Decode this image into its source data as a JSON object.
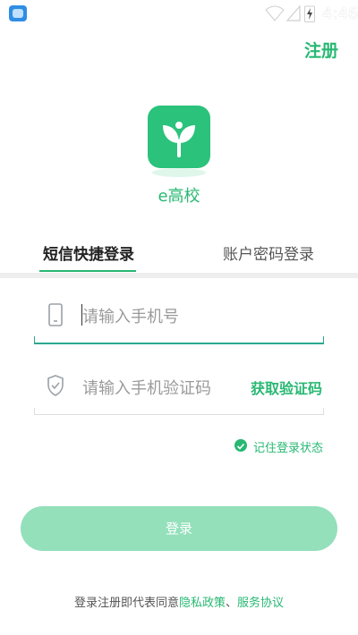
{
  "status_bar": {
    "time": "4:46"
  },
  "header": {
    "register_label": "注册"
  },
  "app": {
    "name": "e高校"
  },
  "tabs": [
    {
      "label": "短信快捷登录",
      "active": true
    },
    {
      "label": "账户密码登录",
      "active": false
    }
  ],
  "form": {
    "phone_placeholder": "请输入手机号",
    "code_placeholder": "请输入手机验证码",
    "get_code_label": "获取验证码",
    "remember_label": "记住登录状态",
    "login_label": "登录"
  },
  "footer": {
    "prefix": "登录注册即代表同意",
    "privacy_label": "隐私政策",
    "separator": "、",
    "service_label": "服务协议"
  },
  "colors": {
    "accent": "#28b873",
    "button_disabled": "#93e0bb",
    "focus_underline": "#2aa88f"
  },
  "icons": [
    "wifi-icon",
    "signal-icon",
    "battery-charging-icon",
    "phone-icon",
    "shield-icon",
    "check-circle-icon",
    "leaf-logo-icon"
  ]
}
